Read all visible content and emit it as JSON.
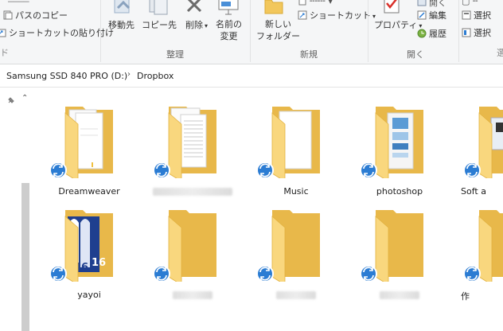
{
  "ribbon": {
    "clipboard_copy_path": "パスのコピー",
    "clipboard_paste_shortcut": "ショートカットの貼り付け",
    "organize": {
      "move_to": "移動先",
      "copy_to": "コピー先",
      "delete": "削除",
      "rename_line1": "名前の",
      "rename_line2": "変更",
      "group_label": "整理"
    },
    "new": {
      "new_folder_line1": "新しい",
      "new_folder_line2": "フォルダー",
      "shortcut": "ショートカット",
      "group_label": "新規"
    },
    "open": {
      "properties": "プロパティ",
      "edit": "編集",
      "history": "履歴",
      "group_label": "開く"
    },
    "select": {
      "select_a": "選択",
      "select_b": "選択"
    }
  },
  "address": {
    "drive": "Samsung SSD 840 PRO (D:)",
    "folder": "Dropbox"
  },
  "folders": [
    {
      "name": "Dreamweaver",
      "blurred": false,
      "type": "docs"
    },
    {
      "name": "",
      "blurred": true,
      "type": "docs2"
    },
    {
      "name": "Music",
      "blurred": false,
      "type": "paper"
    },
    {
      "name": "photoshop",
      "blurred": false,
      "type": "photo"
    },
    {
      "name": "Soft a",
      "blurred": false,
      "type": "soft"
    },
    {
      "name": "yayoi",
      "blurred": false,
      "type": "yayoi"
    },
    {
      "name": "",
      "blurred": true,
      "type": "plain"
    },
    {
      "name": "",
      "blurred": true,
      "type": "plain"
    },
    {
      "name": "",
      "blurred": true,
      "type": "plain"
    },
    {
      "name": "作",
      "blurred": false,
      "type": "plain"
    }
  ],
  "colors": {
    "folder_back": "#e8b84a",
    "folder_front": "#f9d77e",
    "sync_blue": "#2b7cd3",
    "ribbon_bg": "#f5f6f7"
  }
}
